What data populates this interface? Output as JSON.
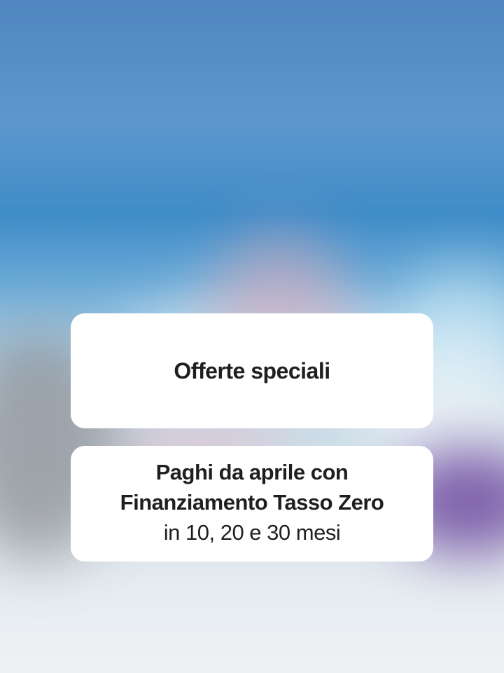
{
  "cards": {
    "title": "Offerte speciali",
    "offer": {
      "line1": "Paghi da aprile con",
      "line2": "Finanziamento Tasso Zero",
      "line3": "in 10, 20 e 30 mesi"
    }
  },
  "colors": {
    "sky": "#4f86bf",
    "card_bg": "#ffffff",
    "text": "#1f1f1f"
  }
}
